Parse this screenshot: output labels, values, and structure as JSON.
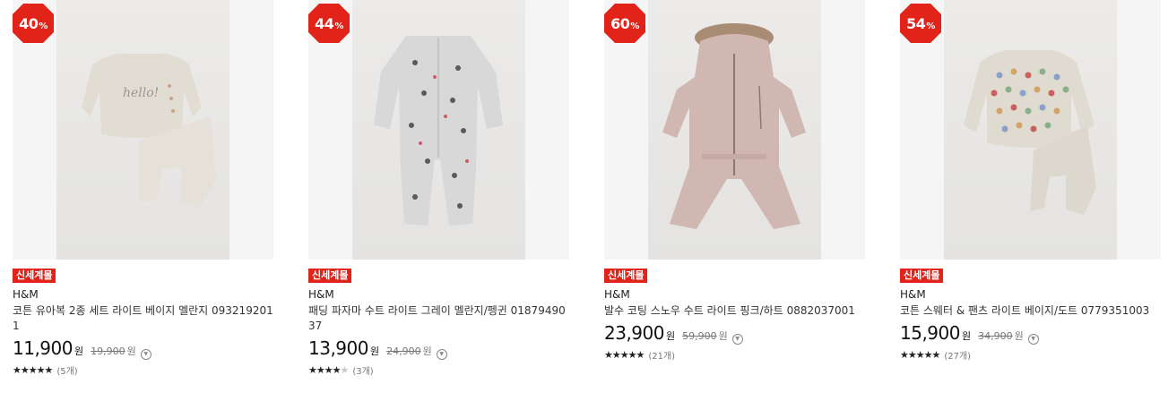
{
  "colors": {
    "badge": "#e2231a",
    "tag": "#e2231a",
    "thumb_bg": "#f5f5f5"
  },
  "products": [
    {
      "discount": "40",
      "discount_unit": "%",
      "tag": "신세계몰",
      "brand": "H&M",
      "name": "코튼 유아복 2종 세트 라이트 베이지 멜란지 0932192011",
      "price": "11,900",
      "currency": "원",
      "original_price": "19,900",
      "original_currency": "원",
      "rating": 5,
      "review_count": "(5개)",
      "image_icon": "baby-sweater-set-image"
    },
    {
      "discount": "44",
      "discount_unit": "%",
      "tag": "신세계몰",
      "brand": "H&M",
      "name": "패딩 파자마 수트 라이트 그레이 멜란지/펭귄 0187949037",
      "price": "13,900",
      "currency": "원",
      "original_price": "24,900",
      "original_currency": "원",
      "rating": 4.5,
      "review_count": "(3개)",
      "image_icon": "pajama-suit-image"
    },
    {
      "discount": "60",
      "discount_unit": "%",
      "tag": "신세계몰",
      "brand": "H&M",
      "name": "발수 코팅 스노우 수트 라이트 핑크/하트 0882037001",
      "price": "23,900",
      "currency": "원",
      "original_price": "59,900",
      "original_currency": "원",
      "rating": 5,
      "review_count": "(21개)",
      "image_icon": "snow-suit-image"
    },
    {
      "discount": "54",
      "discount_unit": "%",
      "tag": "신세계몰",
      "brand": "H&M",
      "name": "코튼 스웨터 & 팬츠 라이트 베이지/도트 0779351003",
      "price": "15,900",
      "currency": "원",
      "original_price": "34,900",
      "original_currency": "원",
      "rating": 5,
      "review_count": "(27개)",
      "image_icon": "sweater-pants-image"
    }
  ]
}
